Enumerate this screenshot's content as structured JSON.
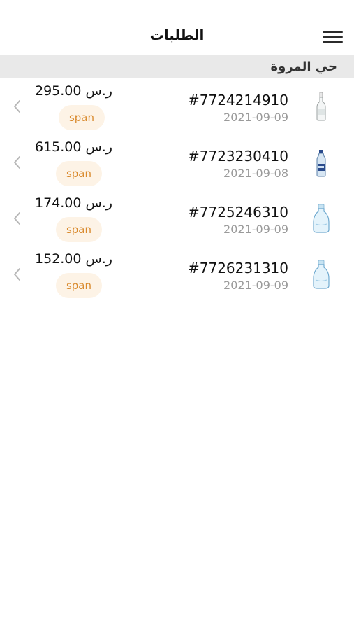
{
  "header": {
    "title": "الطلبات",
    "menu_icon": "hamburger-menu-icon"
  },
  "section": {
    "label": "حي المروة"
  },
  "orders": [
    {
      "id": "#7724214910",
      "date": "2021-09-09",
      "price": "295.00",
      "currency": "ر.س",
      "status": "span",
      "image": "glass-bottle-tall"
    },
    {
      "id": "#7723230410",
      "date": "2021-09-08",
      "price": "615.00",
      "currency": "ر.س",
      "status": "span",
      "image": "water-bottle-small"
    },
    {
      "id": "#7725246310",
      "date": "2021-09-09",
      "price": "174.00",
      "currency": "ر.س",
      "status": "span",
      "image": "water-jug"
    },
    {
      "id": "#7726231310",
      "date": "2021-09-09",
      "price": "152.00",
      "currency": "ر.س",
      "status": "span",
      "image": "water-jug"
    }
  ],
  "colors": {
    "badge_bg": "#fdf3e6",
    "badge_text": "#d98a2d",
    "section_bg": "#e9e9e9"
  }
}
